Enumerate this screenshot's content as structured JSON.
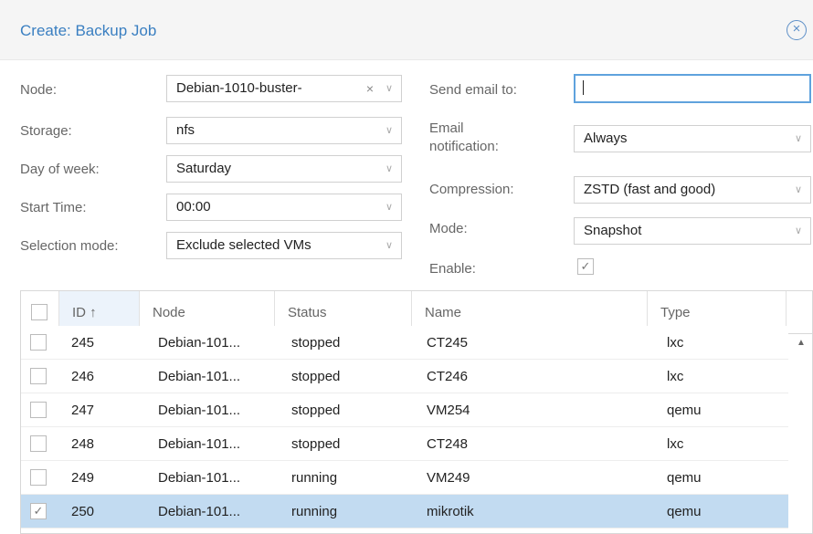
{
  "dialog": {
    "title": "Create: Backup Job",
    "close_icon": "close-circle-icon"
  },
  "form": {
    "node": {
      "label": "Node:",
      "value": "Debian-1010-buster-",
      "clear": "×",
      "arrow": "∨"
    },
    "storage": {
      "label": "Storage:",
      "value": "nfs",
      "arrow": "∨"
    },
    "day_of_week": {
      "label": "Day of week:",
      "value": "Saturday",
      "arrow": "∨"
    },
    "start_time": {
      "label": "Start Time:",
      "value": "00:00",
      "arrow": "∨"
    },
    "selection_mode": {
      "label": "Selection mode:",
      "value": "Exclude selected VMs",
      "arrow": "∨"
    },
    "send_email": {
      "label": "Send email to:",
      "value": ""
    },
    "email_notification": {
      "label_line1": "Email",
      "label_line2": "notification:",
      "value": "Always",
      "arrow": "∨"
    },
    "compression": {
      "label": "Compression:",
      "value": "ZSTD (fast and good)",
      "arrow": "∨"
    },
    "mode": {
      "label": "Mode:",
      "value": "Snapshot",
      "arrow": "∨"
    },
    "enable": {
      "label": "Enable:",
      "checked": true,
      "check": "✓"
    }
  },
  "grid": {
    "columns": [
      "ID ↑",
      "Node",
      "Status",
      "Name",
      "Type"
    ],
    "rows": [
      {
        "id": "245",
        "node": "Debian-101...",
        "status": "stopped",
        "name": "CT245",
        "type": "lxc",
        "checked": false
      },
      {
        "id": "246",
        "node": "Debian-101...",
        "status": "stopped",
        "name": "CT246",
        "type": "lxc",
        "checked": false
      },
      {
        "id": "247",
        "node": "Debian-101...",
        "status": "stopped",
        "name": "VM254",
        "type": "qemu",
        "checked": false
      },
      {
        "id": "248",
        "node": "Debian-101...",
        "status": "stopped",
        "name": "CT248",
        "type": "lxc",
        "checked": false
      },
      {
        "id": "249",
        "node": "Debian-101...",
        "status": "running",
        "name": "VM249",
        "type": "qemu",
        "checked": false
      },
      {
        "id": "250",
        "node": "Debian-101...",
        "status": "running",
        "name": "mikrotik",
        "type": "qemu",
        "checked": true
      }
    ],
    "scroll_up": "▲",
    "check": "✓"
  },
  "colors": {
    "title": "#3a7fc1",
    "selected_row": "#c2dbf1",
    "focus_border": "#5fa2dd"
  }
}
